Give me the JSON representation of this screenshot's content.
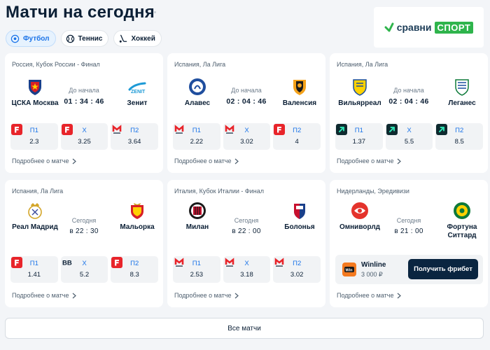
{
  "page": {
    "title": "Матчи на сегодня"
  },
  "brand": {
    "word": "сравни",
    "sport": "СПОРТ",
    "color": "#2fb44c"
  },
  "tabs": [
    {
      "label": "Футбол",
      "icon": "soccer-ball-icon",
      "active": true
    },
    {
      "label": "Теннис",
      "icon": "tennis-ball-icon",
      "active": false
    },
    {
      "label": "Хоккей",
      "icon": "hockey-stick-icon",
      "active": false
    }
  ],
  "matches": [
    {
      "league": "Россия, Кубок России - Финал",
      "home": {
        "name": "ЦСКА Москва",
        "logo": "cska-logo"
      },
      "away": {
        "name": "Зенит",
        "logo": "zenit-logo"
      },
      "status_label": "До начала",
      "time": "01 : 34 : 46",
      "odds": [
        {
          "key": "П1",
          "value": "2.3",
          "bookmaker": "fonbet-icon"
        },
        {
          "key": "Х",
          "value": "3.25",
          "bookmaker": "fonbet-icon"
        },
        {
          "key": "П2",
          "value": "3.64",
          "bookmaker": "melbet-icon"
        }
      ],
      "more": "Подробнее о матче"
    },
    {
      "league": "Испания, Ла Лига",
      "home": {
        "name": "Алавес",
        "logo": "alaves-logo"
      },
      "away": {
        "name": "Валенсия",
        "logo": "valencia-logo"
      },
      "status_label": "До начала",
      "time": "02 : 04 : 46",
      "odds": [
        {
          "key": "П1",
          "value": "2.22",
          "bookmaker": "melbet-icon"
        },
        {
          "key": "Х",
          "value": "3.02",
          "bookmaker": "melbet-icon"
        },
        {
          "key": "П2",
          "value": "4",
          "bookmaker": "fonbet-icon"
        }
      ],
      "more": "Подробнее о матче"
    },
    {
      "league": "Испания, Ла Лига",
      "home": {
        "name": "Вильярреал",
        "logo": "villarreal-logo"
      },
      "away": {
        "name": "Леганес",
        "logo": "leganes-logo"
      },
      "status_label": "До начала",
      "time": "02 : 04 : 46",
      "odds": [
        {
          "key": "П1",
          "value": "1.37",
          "bookmaker": "arrow-bookmaker-icon"
        },
        {
          "key": "Х",
          "value": "5.5",
          "bookmaker": "arrow-bookmaker-icon"
        },
        {
          "key": "П2",
          "value": "8.5",
          "bookmaker": "arrow-bookmaker-icon"
        }
      ],
      "more": "Подробнее о матче"
    },
    {
      "league": "Испания, Ла Лига",
      "home": {
        "name": "Реал Мадрид",
        "logo": "real-madrid-logo"
      },
      "away": {
        "name": "Мальорка",
        "logo": "mallorca-logo"
      },
      "status_label": "Сегодня",
      "time": "в 22 : 30",
      "odds": [
        {
          "key": "П1",
          "value": "1.41",
          "bookmaker": "fonbet-icon"
        },
        {
          "key": "Х",
          "value": "5.2",
          "bookmaker": "bb-bookmaker-icon"
        },
        {
          "key": "П2",
          "value": "8.3",
          "bookmaker": "fonbet-icon"
        }
      ],
      "more": "Подробнее о матче"
    },
    {
      "league": "Италия, Кубок Италии - Финал",
      "home": {
        "name": "Милан",
        "logo": "milan-logo"
      },
      "away": {
        "name": "Болонья",
        "logo": "bologna-logo"
      },
      "status_label": "Сегодня",
      "time": "в 22 : 00",
      "odds": [
        {
          "key": "П1",
          "value": "2.53",
          "bookmaker": "melbet-icon"
        },
        {
          "key": "Х",
          "value": "3.18",
          "bookmaker": "melbet-icon"
        },
        {
          "key": "П2",
          "value": "3.02",
          "bookmaker": "melbet-icon"
        }
      ],
      "more": "Подробнее о матче"
    },
    {
      "league": "Нидерланды, Эредивизи",
      "home": {
        "name": "Омниворлд",
        "logo": "omniworld-logo"
      },
      "away": {
        "name": "Фортуна Ситтард",
        "logo": "fortuna-logo"
      },
      "status_label": "Сегодня",
      "time": "в 21 : 00",
      "promo": {
        "name": "Winline",
        "amount": "3 000 ₽",
        "button": "Получить фрибет",
        "logo": "winline-icon"
      },
      "more": "Подробнее о матче"
    }
  ],
  "all_matches_button": "Все матчи"
}
